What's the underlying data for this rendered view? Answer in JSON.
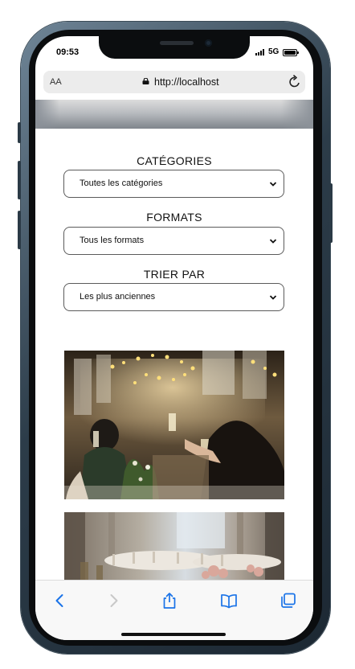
{
  "status": {
    "time": "09:53",
    "network": "5G"
  },
  "browser": {
    "text_size_label": "AA",
    "url": "http://localhost"
  },
  "filters": [
    {
      "label": "CATÉGORIES",
      "selected": "Toutes les catégories"
    },
    {
      "label": "FORMATS",
      "selected": "Tous les formats"
    },
    {
      "label": "TRIER PAR",
      "selected": "Les plus anciennes"
    }
  ],
  "photos": [
    {
      "subject": "wedding reception guests toasting with champagne under string lights"
    },
    {
      "subject": "banquet hall with set tables and pink flowers"
    }
  ],
  "toolbar_icons": [
    "back-icon",
    "forward-icon",
    "share-icon",
    "bookmarks-icon",
    "tabs-icon"
  ],
  "colors": {
    "ios_blue": "#1a73e8",
    "disabled_gray": "#c8c8c8",
    "frame": "#2c3c49"
  }
}
